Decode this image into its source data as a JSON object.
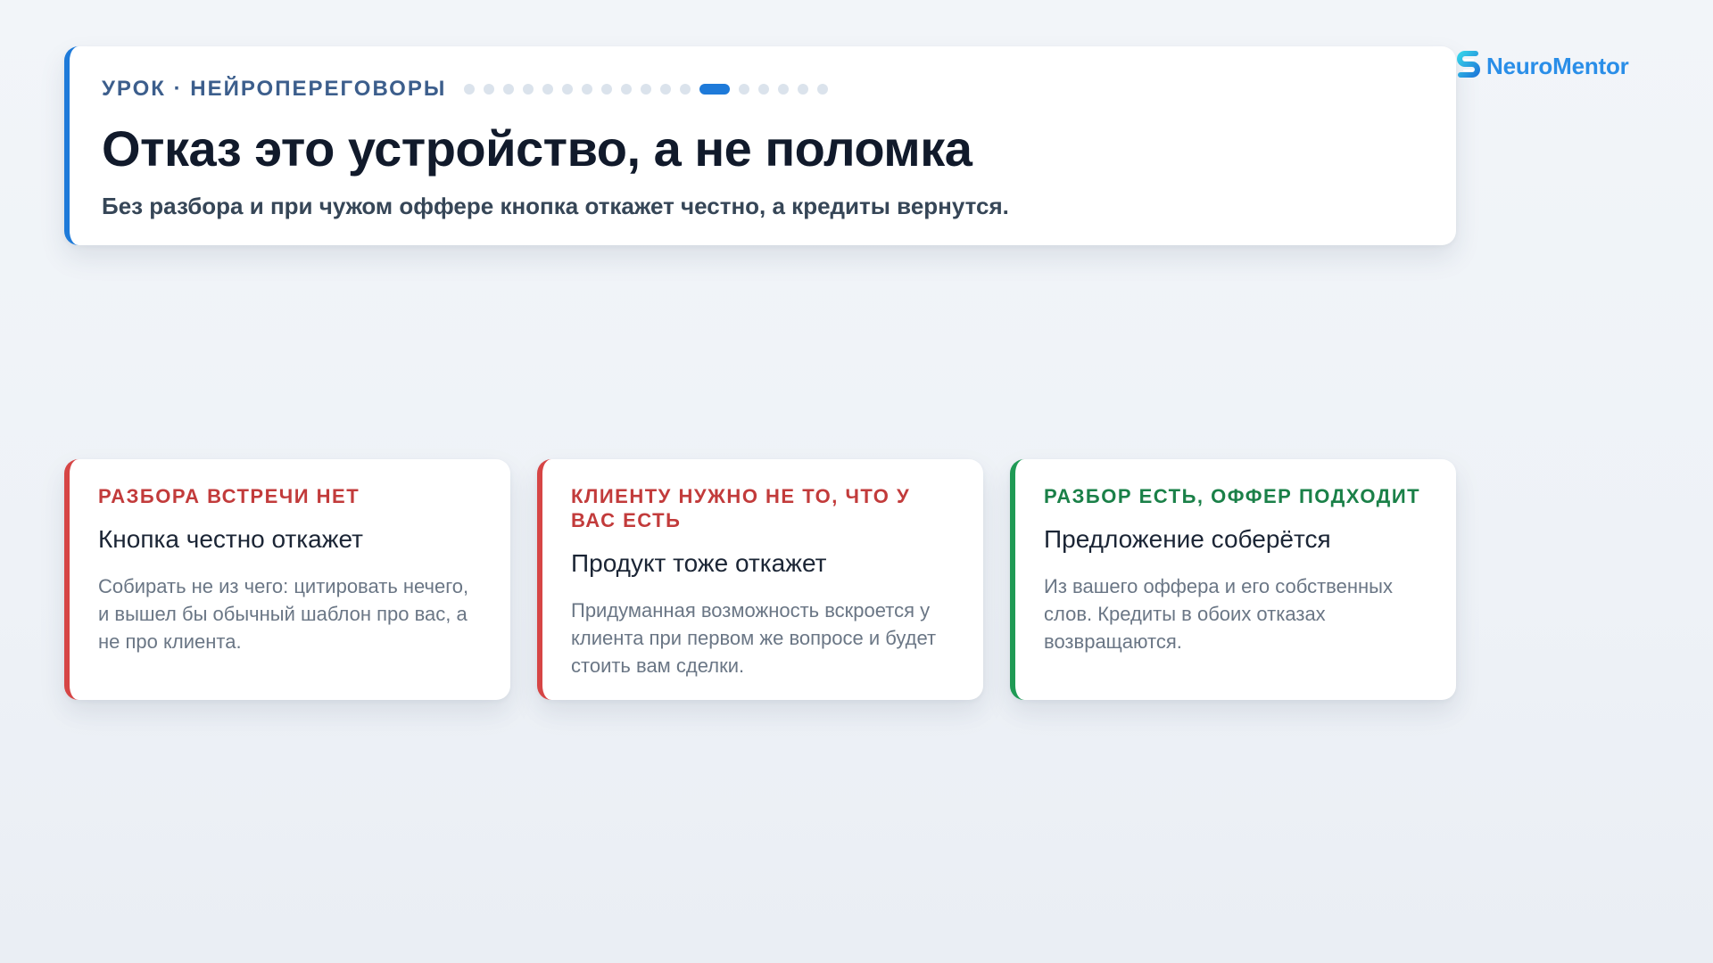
{
  "header": {
    "lesson_tag": "УРОК · НЕЙРОПЕРЕГОВОРЫ",
    "progress": {
      "total": 18,
      "current": 13
    },
    "title": "Отказ это устройство, а не поломка",
    "subtitle": "Без разбора и при чужом оффере кнопка откажет честно, а кредиты вернутся."
  },
  "brand": {
    "name": "NeuroMentor",
    "icon": "neuromentor-logo-icon",
    "color": "#2a8ee8"
  },
  "colors": {
    "accent": "#1e7ad9",
    "negative": "#d64545",
    "positive": "#1f9a55"
  },
  "cards": [
    {
      "status": "negative",
      "label": "РАЗБОРА ВСТРЕЧИ НЕТ",
      "heading": "Кнопка честно откажет",
      "text": "Собирать не из чего: цитировать нечего, и вышел бы обычный шаблон про вас, а не про клиента."
    },
    {
      "status": "negative",
      "label": "КЛИЕНТУ НУЖНО НЕ ТО, ЧТО У ВАС ЕСТЬ",
      "heading": "Продукт тоже откажет",
      "text": "Придуманная возможность вскроется у клиента при первом же вопросе и будет стоить вам сделки."
    },
    {
      "status": "positive",
      "label": "РАЗБОР ЕСТЬ, ОФФЕР ПОДХОДИТ",
      "heading": "Предложение соберётся",
      "text": "Из вашего оффера и его собственных слов. Кредиты в обоих отказах возвращаются."
    }
  ]
}
